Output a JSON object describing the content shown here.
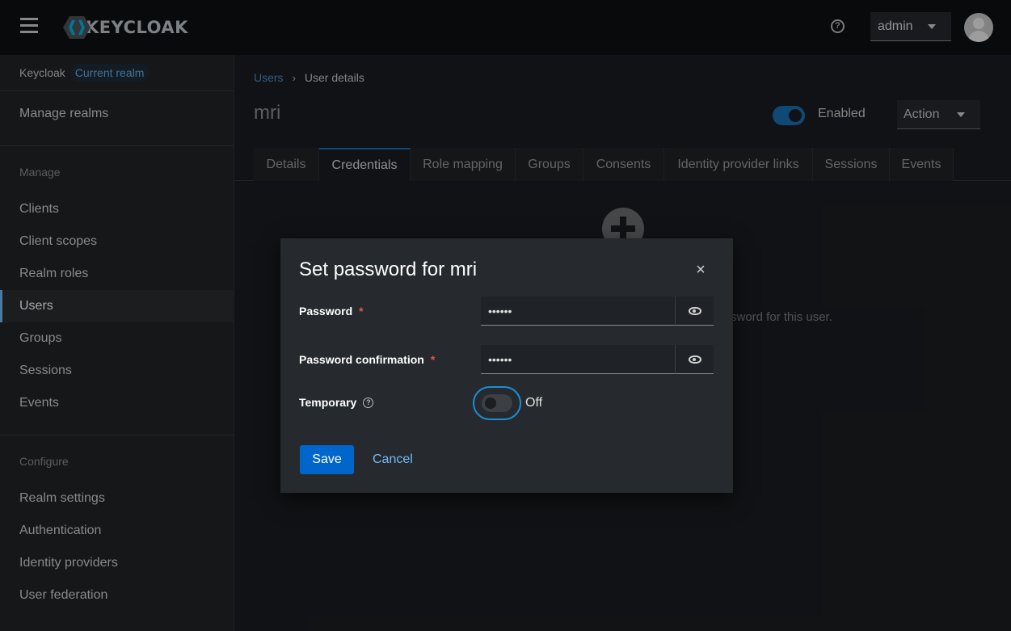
{
  "header": {
    "logo_text": "KEYCLOAK",
    "user_menu": "admin"
  },
  "sidebar": {
    "realm_name": "Keycloak",
    "realm_badge": "Current realm",
    "manage_realms": "Manage realms",
    "section_manage": "Manage",
    "manage_items": [
      "Clients",
      "Client scopes",
      "Realm roles",
      "Users",
      "Groups",
      "Sessions",
      "Events"
    ],
    "section_configure": "Configure",
    "configure_items": [
      "Realm settings",
      "Authentication",
      "Identity providers",
      "User federation"
    ]
  },
  "main": {
    "breadcrumb": {
      "parent": "Users",
      "current": "User details"
    },
    "title": "mri",
    "enabled_label": "Enabled",
    "action_label": "Action",
    "tabs": [
      "Details",
      "Credentials",
      "Role mapping",
      "Groups",
      "Consents",
      "Identity provider links",
      "Sessions",
      "Events"
    ],
    "empty_text": "sword for this user."
  },
  "modal": {
    "title": "Set password for mri",
    "close": "×",
    "password_label": "Password",
    "password_value": "••••••",
    "confirm_label": "Password confirmation",
    "confirm_value": "••••••",
    "required_mark": "*",
    "temporary_label": "Temporary",
    "temporary_status": "Off",
    "save_label": "Save",
    "cancel_label": "Cancel"
  },
  "colors": {
    "accent": "#0066cc",
    "link": "#73bcf7",
    "required": "#e0574d"
  }
}
